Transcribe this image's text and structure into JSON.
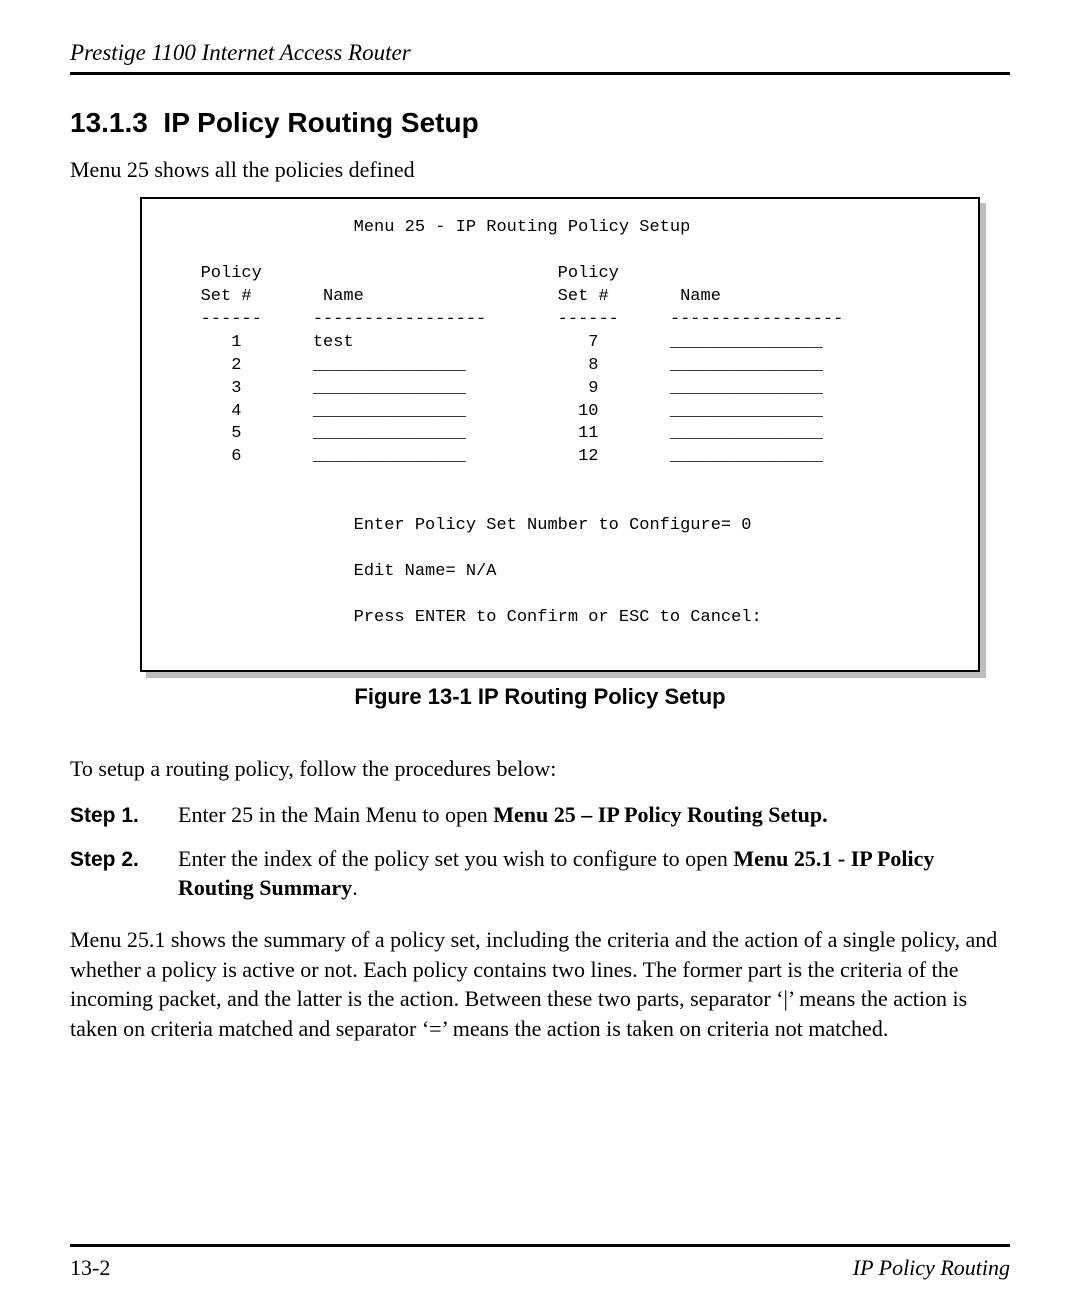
{
  "header": {
    "running_title": "Prestige 1100 Internet Access Router"
  },
  "section": {
    "number": "13.1.3",
    "title": "IP Policy Routing Setup"
  },
  "intro": "Menu 25 shows all the policies defined",
  "terminal": {
    "title": "Menu 25 - IP Routing Policy Setup",
    "col_header_left_set": "Policy",
    "col_header_left_set2": "Set #",
    "col_header_left_name": "Name",
    "col_header_right_set": "Policy",
    "col_header_right_set2": "Set #",
    "col_header_right_name": "Name",
    "sep_short": "------",
    "sep_long": "-----------------",
    "rows_left": [
      {
        "num": "1",
        "name": "test"
      },
      {
        "num": "2",
        "name": "_______________"
      },
      {
        "num": "3",
        "name": "_______________"
      },
      {
        "num": "4",
        "name": "_______________"
      },
      {
        "num": "5",
        "name": "_______________"
      },
      {
        "num": "6",
        "name": "_______________"
      }
    ],
    "rows_right": [
      {
        "num": "7",
        "name": "_______________"
      },
      {
        "num": "8",
        "name": "_______________"
      },
      {
        "num": "9",
        "name": "_______________"
      },
      {
        "num": "10",
        "name": "_______________"
      },
      {
        "num": "11",
        "name": "_______________"
      },
      {
        "num": "12",
        "name": "_______________"
      }
    ],
    "enter_line": "Enter Policy Set Number to Configure= 0",
    "edit_line": "Edit Name= N/A",
    "press_line": "Press ENTER to Confirm or ESC to Cancel:"
  },
  "figure_caption": "Figure 13-1 IP Routing Policy Setup",
  "proc_intro": "To setup a routing policy, follow the procedures below:",
  "steps": [
    {
      "label": "Step 1.",
      "plain": "Enter 25 in the Main Menu to open ",
      "bold": "Menu 25 – IP Policy Routing Setup."
    },
    {
      "label": "Step 2.",
      "plain": "Enter the index of the policy set you wish to configure to open ",
      "bold": "Menu 25.1 - IP Policy Routing Summary",
      "tail": "."
    }
  ],
  "paragraph": "Menu 25.1 shows the summary of a policy set, including the criteria and the action of a single policy, and whether a policy is active or not.  Each policy contains two lines.  The former part is the criteria of the incoming packet, and the latter is the action.  Between these two parts, separator ‘|’ means the action is taken on criteria matched and separator ‘=’ means the action is taken on criteria not matched.",
  "footer": {
    "page_number": "13-2",
    "section_title": "IP Policy Routing"
  }
}
